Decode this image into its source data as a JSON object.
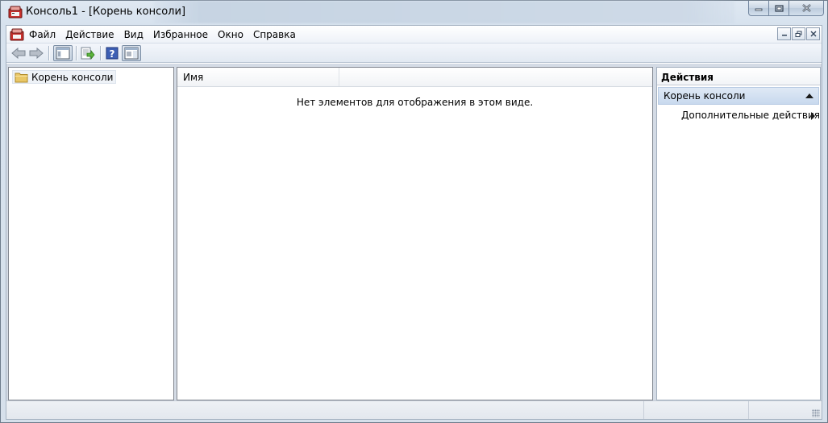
{
  "window": {
    "title": "Консоль1 - [Корень консоли]"
  },
  "menu": {
    "items": [
      "Файл",
      "Действие",
      "Вид",
      "Избранное",
      "Окно",
      "Справка"
    ]
  },
  "toolbar": {
    "icons": [
      "back-arrow-icon",
      "forward-arrow-icon",
      "show-hide-console-tree-icon",
      "export-list-icon",
      "help-icon",
      "show-hide-action-pane-icon"
    ]
  },
  "tree": {
    "root_label": "Корень консоли"
  },
  "list": {
    "columns": [
      "Имя"
    ],
    "empty_message": "Нет элементов для отображения в этом виде."
  },
  "actions": {
    "header": "Действия",
    "section_title": "Корень консоли",
    "items": [
      "Дополнительные действия"
    ]
  },
  "colors": {
    "frame": "#d7e2ee",
    "selection": "#c8d9ee",
    "pane_border": "#828790"
  }
}
